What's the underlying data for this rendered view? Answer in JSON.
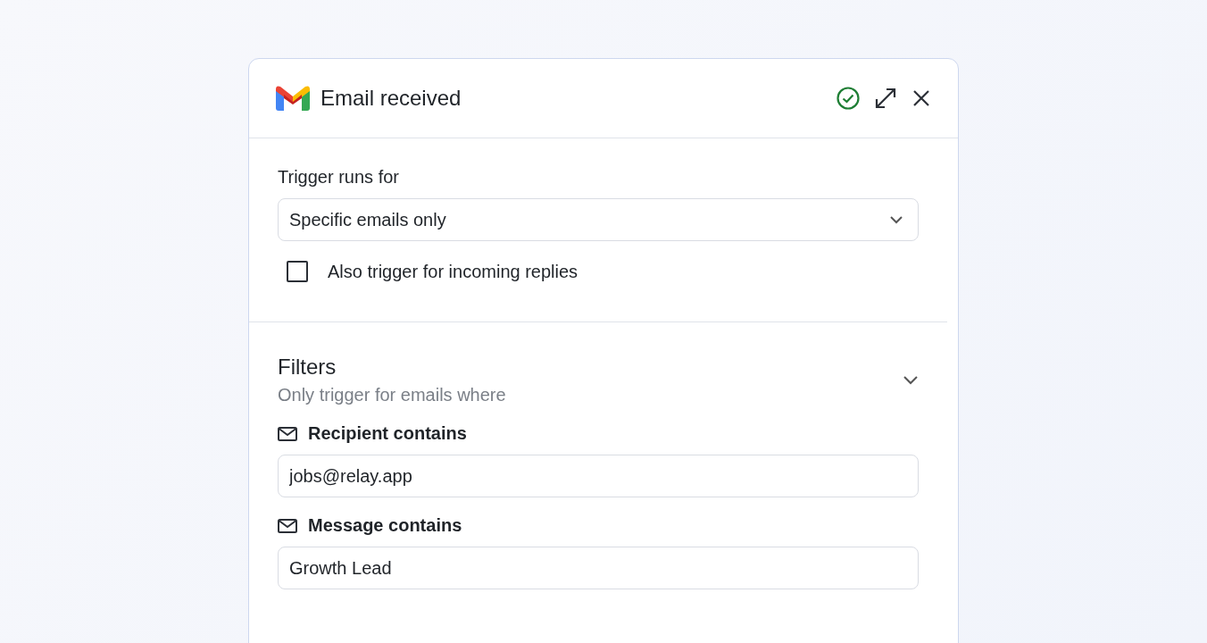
{
  "panel": {
    "title": "Email received"
  },
  "trigger": {
    "label": "Trigger runs for",
    "value": "Specific emails only",
    "replies": {
      "label": "Also trigger for incoming replies",
      "checked": false
    }
  },
  "filters": {
    "title": "Filters",
    "subtitle": "Only trigger for emails where",
    "expanded": true,
    "items": [
      {
        "label": "Recipient contains",
        "value": "jobs@relay.app"
      },
      {
        "label": "Message contains",
        "value": "Growth Lead"
      }
    ]
  }
}
